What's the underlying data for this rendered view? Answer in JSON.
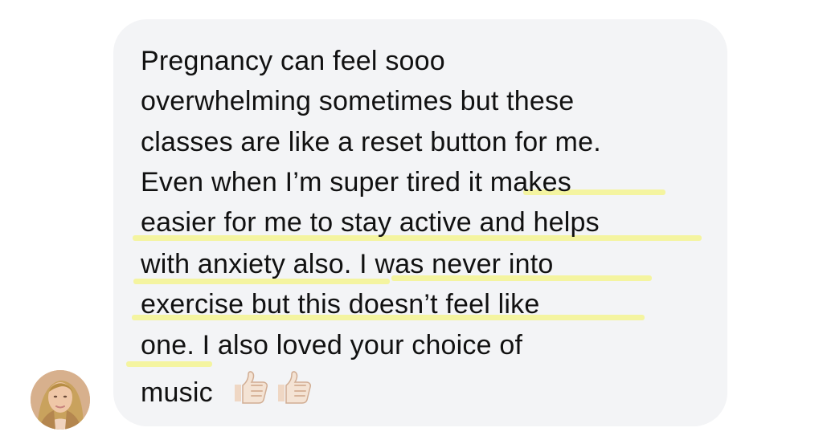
{
  "message": {
    "lines": [
      "Pregnancy can feel sooo",
      "overwhelming sometimes but these",
      "classes are like a reset button for me.",
      "Even when I’m super tired it makes",
      "easier for me to stay active and helps",
      "with anxiety also. I was never into",
      "exercise but this doesn’t feel like",
      "one. I also loved your choice of",
      "music"
    ],
    "emojis": [
      "thumbs-up-icon",
      "thumbs-up-icon"
    ]
  },
  "colors": {
    "bubble": "#f3f4f6",
    "highlight": "#f3f39b",
    "text": "#111111"
  }
}
